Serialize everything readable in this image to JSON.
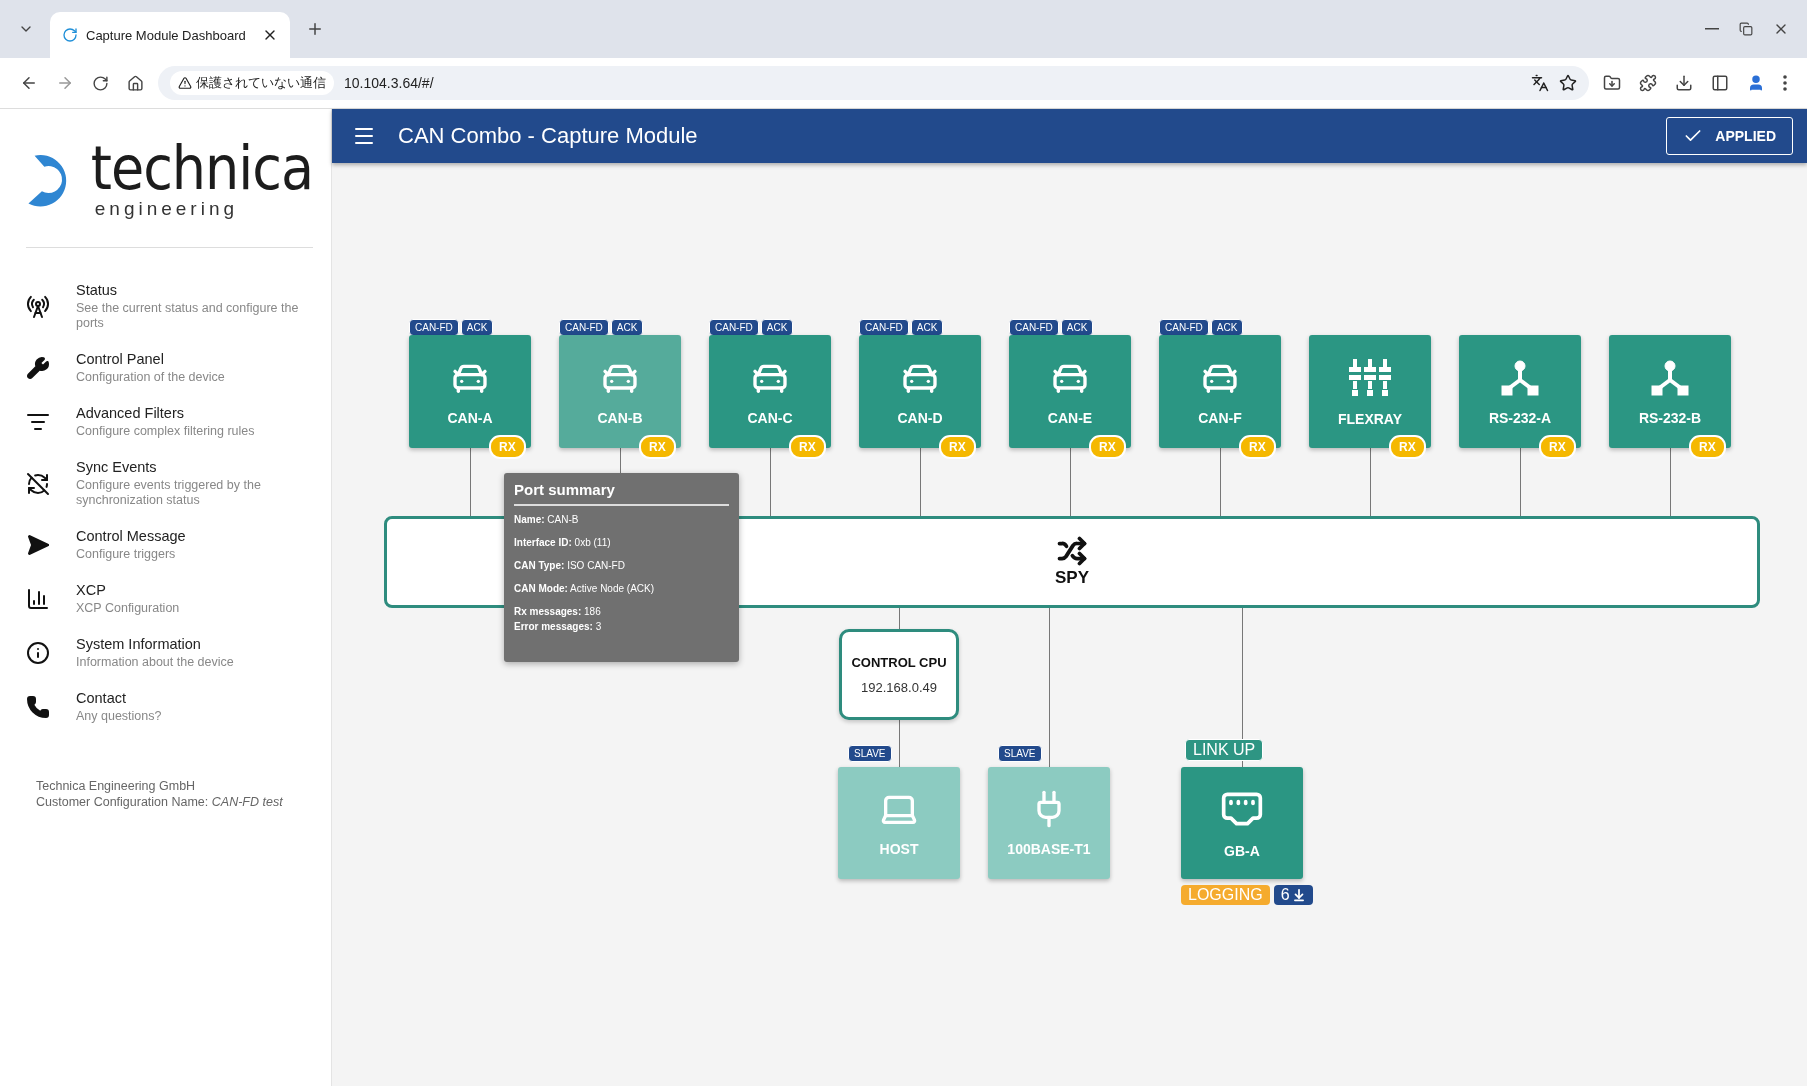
{
  "browser": {
    "tab_title": "Capture Module Dashboard",
    "security_label": "保護されていない通信",
    "url": "10.104.3.64/#/"
  },
  "header": {
    "title": "CAN Combo - Capture Module",
    "apply_button": "APPLIED"
  },
  "logo": {
    "name": "technica",
    "tagline": "engineering"
  },
  "sidebar": {
    "items": [
      {
        "title": "Status",
        "subtitle": "See the current status and configure the ports",
        "kind": "status"
      },
      {
        "title": "Control Panel",
        "subtitle": "Configuration of the device",
        "kind": "control"
      },
      {
        "title": "Advanced Filters",
        "subtitle": "Configure complex filtering rules",
        "kind": "filters"
      },
      {
        "title": "Sync Events",
        "subtitle": "Configure events triggered by the synchronization status",
        "kind": "sync"
      },
      {
        "title": "Control Message",
        "subtitle": "Configure triggers",
        "kind": "message"
      },
      {
        "title": "XCP",
        "subtitle": "XCP Configuration",
        "kind": "xcp"
      },
      {
        "title": "System Information",
        "subtitle": "Information about the device",
        "kind": "info"
      },
      {
        "title": "Contact",
        "subtitle": "Any questions?",
        "kind": "contact"
      }
    ],
    "footer": [
      "Technica Engineering GmbH",
      "Customer Configuration Name: *CAN-FD test*"
    ]
  },
  "ports": [
    {
      "name": "CAN-A",
      "kind": "can",
      "tags": [
        "CAN-FD",
        "ACK"
      ],
      "badge": "RX",
      "selected": false
    },
    {
      "name": "CAN-B",
      "kind": "can",
      "tags": [
        "CAN-FD",
        "ACK"
      ],
      "badge": "RX",
      "selected": true
    },
    {
      "name": "CAN-C",
      "kind": "can",
      "tags": [
        "CAN-FD",
        "ACK"
      ],
      "badge": "RX",
      "selected": false
    },
    {
      "name": "CAN-D",
      "kind": "can",
      "tags": [
        "CAN-FD",
        "ACK"
      ],
      "badge": "RX",
      "selected": false
    },
    {
      "name": "CAN-E",
      "kind": "can",
      "tags": [
        "CAN-FD",
        "ACK"
      ],
      "badge": "RX",
      "selected": false
    },
    {
      "name": "CAN-F",
      "kind": "can",
      "tags": [
        "CAN-FD",
        "ACK"
      ],
      "badge": "RX",
      "selected": false
    },
    {
      "name": "FLEXRAY",
      "kind": "flexray",
      "badge": "RX",
      "selected": false
    },
    {
      "name": "RS-232-A",
      "kind": "rs232",
      "badge": "RX",
      "selected": false
    },
    {
      "name": "RS-232-B",
      "kind": "rs232",
      "badge": "RX",
      "selected": false
    }
  ],
  "spy": {
    "label": "SPY"
  },
  "control_cpu": {
    "title": "CONTROL CPU",
    "ip": "192.168.0.49"
  },
  "links": [
    {
      "name": "HOST",
      "kind": "host",
      "tag": "SLAVE",
      "active": false
    },
    {
      "name": "100BASE-T1",
      "kind": "t1",
      "tag": "SLAVE",
      "active": false
    },
    {
      "name": "GB-A",
      "kind": "ethernet",
      "status": "LINK UP",
      "active": true,
      "badges": [
        {
          "text": "LOGGING",
          "kind": "logging"
        },
        {
          "text": "6",
          "kind": "download"
        }
      ]
    }
  ],
  "tooltip": {
    "title": "Port summary",
    "lines": [
      "**Name:** CAN-B",
      "**Interface ID:** 0xb (11)",
      "**CAN Type:** ISO CAN-FD",
      "**CAN Mode:** Active Node (ACK)",
      "**Rx messages:** 186",
      "**Error messages:** 3"
    ]
  }
}
